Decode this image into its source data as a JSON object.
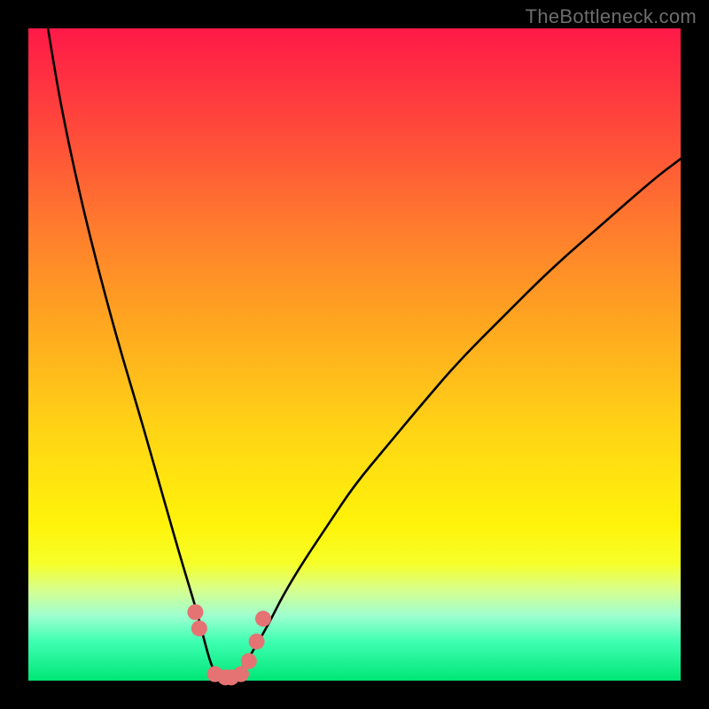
{
  "watermark": "TheBottleneck.com",
  "colors": {
    "curve_stroke": "#000000",
    "marker_fill": "#e57373",
    "marker_stroke": "#c05a5a",
    "bg_black": "#000000"
  },
  "chart_data": {
    "type": "line",
    "title": "",
    "xlabel": "",
    "ylabel": "",
    "xlim": [
      0,
      100
    ],
    "ylim": [
      0,
      100
    ],
    "x": [
      3,
      5,
      8,
      11,
      14,
      17,
      19,
      21,
      23,
      24.5,
      26,
      27,
      28,
      28.8,
      29.4,
      30,
      31,
      32,
      33,
      35,
      37,
      39,
      42,
      46,
      50,
      55,
      60,
      66,
      73,
      80,
      88,
      96,
      100
    ],
    "values": [
      100,
      88,
      74,
      62,
      51,
      41,
      34,
      27,
      20,
      15,
      10,
      6,
      2.5,
      0.8,
      0,
      0,
      0,
      0.6,
      2.2,
      5.5,
      9,
      13,
      18,
      24,
      30,
      36,
      42,
      49,
      56,
      63,
      70,
      77,
      80
    ],
    "markers": [
      {
        "x": 25.6,
        "y": 10.5
      },
      {
        "x": 26.2,
        "y": 8.0
      },
      {
        "x": 28.6,
        "y": 1.0
      },
      {
        "x": 30.2,
        "y": 0.5
      },
      {
        "x": 31.1,
        "y": 0.5
      },
      {
        "x": 32.6,
        "y": 1.0
      },
      {
        "x": 33.8,
        "y": 3.0
      },
      {
        "x": 35.0,
        "y": 6.0
      },
      {
        "x": 36.0,
        "y": 9.5
      }
    ],
    "gradient_stops": [
      {
        "pos": 0.0,
        "color": "#ff1948"
      },
      {
        "pos": 0.16,
        "color": "#ff4b3a"
      },
      {
        "pos": 0.3,
        "color": "#ff7a2e"
      },
      {
        "pos": 0.44,
        "color": "#ffa321"
      },
      {
        "pos": 0.62,
        "color": "#ffd515"
      },
      {
        "pos": 0.76,
        "color": "#fff30a"
      },
      {
        "pos": 0.82,
        "color": "#f6ff28"
      },
      {
        "pos": 0.86,
        "color": "#d8ff8c"
      },
      {
        "pos": 0.9,
        "color": "#9fffd0"
      },
      {
        "pos": 0.94,
        "color": "#3fffb2"
      },
      {
        "pos": 1.0,
        "color": "#00e676"
      }
    ]
  }
}
